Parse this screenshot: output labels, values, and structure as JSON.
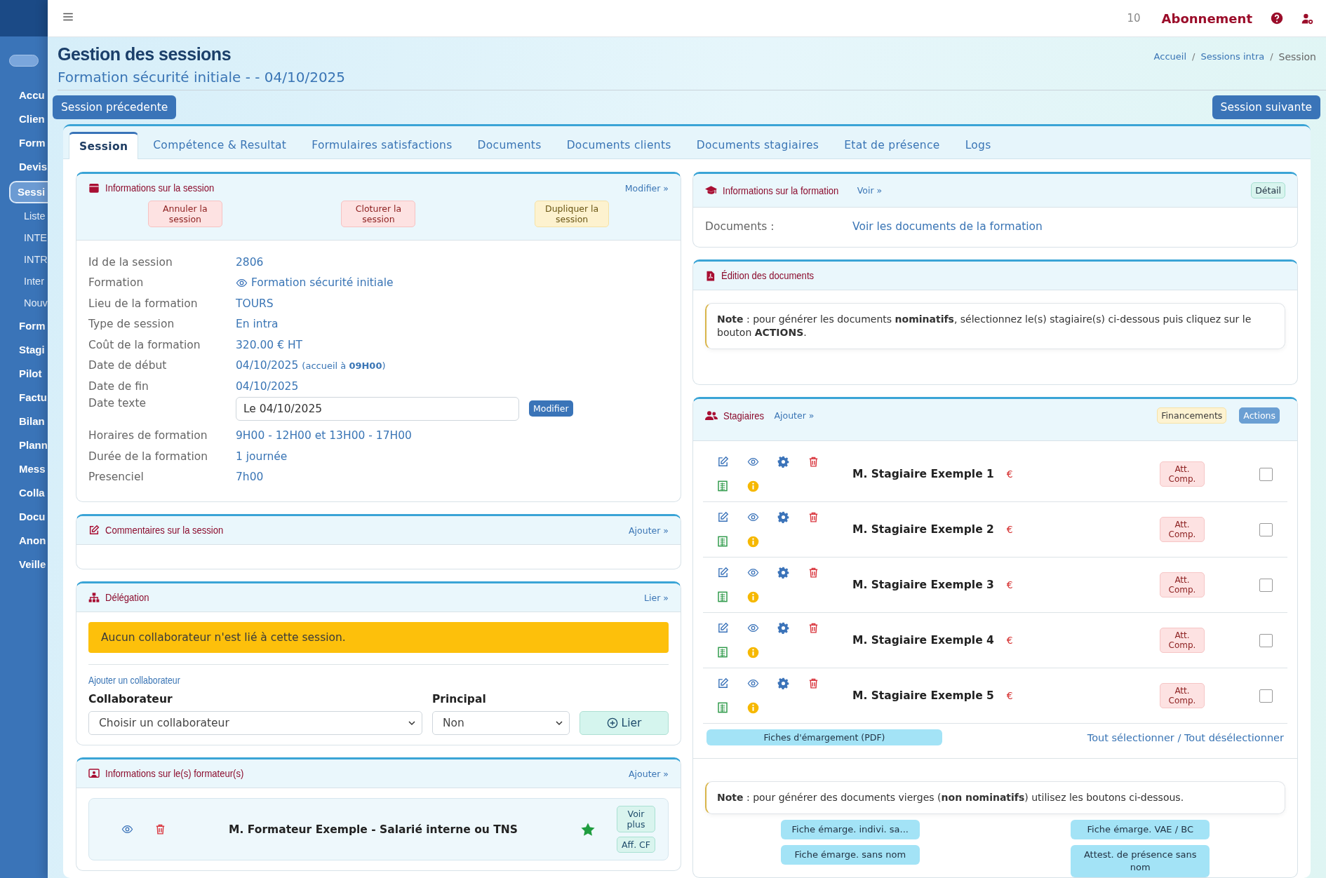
{
  "topbar": {
    "count": "10",
    "subscription": "Abonnement"
  },
  "sidebar": {
    "toggle": {
      "on": false
    },
    "items": [
      {
        "label": "Accu",
        "selected": false
      },
      {
        "label": "Clien",
        "selected": false
      },
      {
        "label": "Form",
        "selected": false
      },
      {
        "label": "Devis",
        "selected": false
      },
      {
        "label": "Sessi",
        "selected": true,
        "children": [
          {
            "label": "Liste",
            "selected": false
          },
          {
            "label": "INTE",
            "selected": false
          },
          {
            "label": "INTR",
            "selected": false
          },
          {
            "label": "Inter",
            "selected": false
          },
          {
            "label": "Nouv",
            "selected": false
          }
        ]
      },
      {
        "label": "Form",
        "selected": false
      },
      {
        "label": "Stagi",
        "selected": false
      },
      {
        "label": "Pilot",
        "selected": false
      },
      {
        "label": "Factu",
        "selected": false
      },
      {
        "label": "Bilan",
        "selected": false
      },
      {
        "label": "Plann",
        "selected": false
      },
      {
        "label": "Mess",
        "selected": false
      },
      {
        "label": "Colla",
        "selected": false
      },
      {
        "label": "Docu",
        "selected": false
      },
      {
        "label": "Anon",
        "selected": false
      },
      {
        "label": "Veille",
        "selected": false
      }
    ]
  },
  "header": {
    "title": "Gestion des sessions",
    "subtitle": "Formation sécurité initiale - - 04/10/2025",
    "breadcrumb_separator": "/",
    "breadcrumb": [
      {
        "label": "Accueil",
        "kind": "link"
      },
      {
        "label": "Sessions intra",
        "kind": "link"
      },
      {
        "label": "Session",
        "kind": "current"
      }
    ]
  },
  "nav": {
    "previous": "Session précedente",
    "next": "Session suivante"
  },
  "tabs": [
    {
      "label": "Session",
      "selected": true
    },
    {
      "label": "Compétence & Resultat",
      "selected": false
    },
    {
      "label": "Formulaires satisfactions",
      "selected": false
    },
    {
      "label": "Documents",
      "selected": false
    },
    {
      "label": "Documents clients",
      "selected": false
    },
    {
      "label": "Documents stagiaires",
      "selected": false
    },
    {
      "label": "Etat de présence",
      "selected": false
    },
    {
      "label": "Logs",
      "selected": false
    }
  ],
  "session_info": {
    "title": "Informations sur la session",
    "link": "Modifier »",
    "actions": [
      {
        "label": "Annuler la session",
        "kind": "danger"
      },
      {
        "label": "Cloturer la session",
        "kind": "danger"
      },
      {
        "label": "Dupliquer la session",
        "kind": "warning"
      }
    ],
    "fields": [
      {
        "label": "Id de la session",
        "value": "2806",
        "kind": "text"
      },
      {
        "label": "Formation",
        "value": "Formation sécurité initiale",
        "kind": "link"
      },
      {
        "label": "Lieu de la formation",
        "value": "TOURS",
        "kind": "text"
      },
      {
        "label": "Type de session",
        "value": "En intra",
        "kind": "text"
      },
      {
        "label": "Coût de la formation",
        "value": "320.00 € HT",
        "kind": "text"
      },
      {
        "label": "Date de début",
        "value": "04/10/2025",
        "note": "(accueil à **09H00**)",
        "kind": "date"
      },
      {
        "label": "Date de fin",
        "value": "04/10/2025",
        "kind": "text"
      },
      {
        "label": "Date texte",
        "value": "Le 04/10/2025",
        "button": "Modifier",
        "kind": "input"
      },
      {
        "label": "Horaires de formation",
        "value": "9H00 - 12H00 et 13H00 - 17H00",
        "kind": "text"
      },
      {
        "label": "Durée de la formation",
        "value": "1 journée",
        "kind": "text"
      },
      {
        "label": "Presenciel",
        "value": "7h00",
        "kind": "text"
      }
    ]
  },
  "comments": {
    "title": "Commentaires sur la session",
    "link": "Ajouter »"
  },
  "delegation": {
    "title": "Délégation",
    "link": "Lier »",
    "alert": "Aucun collaborateur n'est lié à cette session.",
    "subtitle": "Ajouter un collaborateur",
    "collaborator_label": "Collaborateur",
    "collaborator_value": "Choisir un collaborateur",
    "principal_label": "Principal",
    "principal_value": "Non",
    "button": "Lier"
  },
  "trainers": {
    "title": "Informations sur le(s) formateur(s)",
    "link": "Ajouter »",
    "items": [
      {
        "name": "M. Formateur Exemple - Salarié interne ou TNS",
        "starred": true,
        "buttons": [
          "Voir plus",
          "Aff. CF"
        ]
      }
    ]
  },
  "formation_info": {
    "title": "Informations sur la formation",
    "link": "Voir »",
    "badge": "Détail",
    "fields": [
      {
        "label": "Documents :",
        "value": "Voir les documents de la formation"
      }
    ]
  },
  "documents": {
    "title": "Édition des documents",
    "note": "**Note** : pour générer les documents **nominatifs**, sélectionnez le(s) stagiaire(s) ci-dessous puis cliquez sur le bouton **ACTIONS**."
  },
  "trainees": {
    "title": "Stagiaires",
    "link": "Ajouter »",
    "buttons": [
      {
        "label": "Financements",
        "kind": "warning"
      },
      {
        "label": "Actions",
        "kind": "primary"
      }
    ],
    "rows": [
      {
        "name": "M. Stagiaire Exemple 1",
        "currency": "€",
        "badge": "Att. Comp.",
        "checked": false
      },
      {
        "name": "M. Stagiaire Exemple 2",
        "currency": "€",
        "badge": "Att. Comp.",
        "checked": false
      },
      {
        "name": "M. Stagiaire Exemple 3",
        "currency": "€",
        "badge": "Att. Comp.",
        "checked": false
      },
      {
        "name": "M. Stagiaire Exemple 4",
        "currency": "€",
        "badge": "Att. Comp.",
        "checked": false
      },
      {
        "name": "M. Stagiaire Exemple 5",
        "currency": "€",
        "badge": "Att. Comp.",
        "checked": false
      }
    ],
    "pdf_button": "Fiches d'émargement (PDF)",
    "select_all": "Tout sélectionner / Tout désélectionner",
    "note": "**Note** : pour générer des documents vierges (**non nominatifs**) utilisez les boutons ci-dessous.",
    "blank_buttons": [
      "Fiche émarge. indivi. sa...",
      "Fiche émarge. VAE / BC",
      "Fiche émarge. sans nom",
      "Attest. de présence sans nom"
    ]
  }
}
